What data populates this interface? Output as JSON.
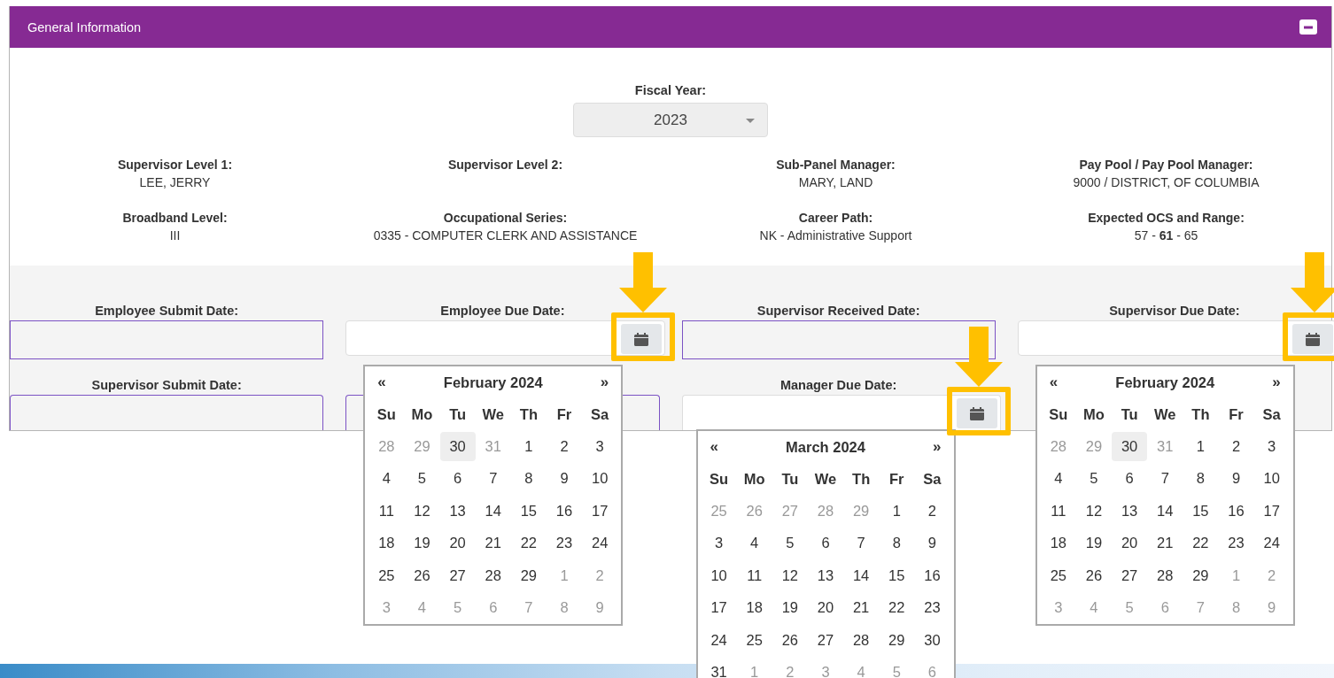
{
  "panel": {
    "title": "General Information",
    "expanded": true
  },
  "fiscal_year": {
    "label": "Fiscal Year:",
    "value": "2023"
  },
  "info": [
    {
      "label": "Supervisor Level 1:",
      "value": "LEE, JERRY"
    },
    {
      "label": "Supervisor Level 2:"
    },
    {
      "label": "Sub-Panel Manager:",
      "value": "MARY, LAND"
    },
    {
      "label": "Pay Pool / Pay Pool Manager:",
      "value": "9000 / DISTRICT, OF COLUMBIA"
    },
    {
      "label": "Broadband Level:",
      "value": "III"
    },
    {
      "label": "Occupational Series:",
      "value": "0335 - COMPUTER CLERK AND ASSISTANCE"
    },
    {
      "label": "Career Path:",
      "value": "NK - Administrative Support"
    },
    {
      "label": "Expected OCS and Range:",
      "value": "57 - **61** - 65"
    }
  ],
  "date_fields": [
    {
      "kind": "readonly",
      "label": "Employee Submit Date:"
    },
    {
      "kind": "picker",
      "label": "Employee Due Date:",
      "highlighted": true,
      "calendar": {
        "title": "February 2024",
        "prev": "«",
        "next": "»",
        "weekdays": [
          "Su",
          "Mo",
          "Tu",
          "We",
          "Th",
          "Fr",
          "Sa"
        ],
        "weeks": [
          [
            {
              "day": "28",
              "muted": true,
              "selected": false
            },
            {
              "day": "29",
              "muted": true,
              "selected": false
            },
            {
              "day": "30",
              "muted": false,
              "selected": true
            },
            {
              "day": "31",
              "muted": true,
              "selected": false
            },
            {
              "day": "1",
              "muted": false,
              "selected": false
            },
            {
              "day": "2",
              "muted": false,
              "selected": false
            },
            {
              "day": "3",
              "muted": false,
              "selected": false
            }
          ],
          [
            {
              "day": "4",
              "muted": false,
              "selected": false
            },
            {
              "day": "5",
              "muted": false,
              "selected": false
            },
            {
              "day": "6",
              "muted": false,
              "selected": false
            },
            {
              "day": "7",
              "muted": false,
              "selected": false
            },
            {
              "day": "8",
              "muted": false,
              "selected": false
            },
            {
              "day": "9",
              "muted": false,
              "selected": false
            },
            {
              "day": "10",
              "muted": false,
              "selected": false
            }
          ],
          [
            {
              "day": "11",
              "muted": false,
              "selected": false
            },
            {
              "day": "12",
              "muted": false,
              "selected": false
            },
            {
              "day": "13",
              "muted": false,
              "selected": false
            },
            {
              "day": "14",
              "muted": false,
              "selected": false
            },
            {
              "day": "15",
              "muted": false,
              "selected": false
            },
            {
              "day": "16",
              "muted": false,
              "selected": false
            },
            {
              "day": "17",
              "muted": false,
              "selected": false
            }
          ],
          [
            {
              "day": "18",
              "muted": false,
              "selected": false
            },
            {
              "day": "19",
              "muted": false,
              "selected": false
            },
            {
              "day": "20",
              "muted": false,
              "selected": false
            },
            {
              "day": "21",
              "muted": false,
              "selected": false
            },
            {
              "day": "22",
              "muted": false,
              "selected": false
            },
            {
              "day": "23",
              "muted": false,
              "selected": false
            },
            {
              "day": "24",
              "muted": false,
              "selected": false
            }
          ],
          [
            {
              "day": "25",
              "muted": false,
              "selected": false
            },
            {
              "day": "26",
              "muted": false,
              "selected": false
            },
            {
              "day": "27",
              "muted": false,
              "selected": false
            },
            {
              "day": "28",
              "muted": false,
              "selected": false
            },
            {
              "day": "29",
              "muted": false,
              "selected": false
            },
            {
              "day": "1",
              "muted": true,
              "selected": false
            },
            {
              "day": "2",
              "muted": true,
              "selected": false
            }
          ],
          [
            {
              "day": "3",
              "muted": true,
              "selected": false
            },
            {
              "day": "4",
              "muted": true,
              "selected": false
            },
            {
              "day": "5",
              "muted": true,
              "selected": false
            },
            {
              "day": "6",
              "muted": true,
              "selected": false
            },
            {
              "day": "7",
              "muted": true,
              "selected": false
            },
            {
              "day": "8",
              "muted": true,
              "selected": false
            },
            {
              "day": "9",
              "muted": true,
              "selected": false
            }
          ]
        ]
      }
    },
    {
      "kind": "readonly",
      "label": "Supervisor Received Date:"
    },
    {
      "kind": "picker",
      "label": "Supervisor Due Date:",
      "highlighted": true,
      "calendar": {
        "title": "February 2024",
        "prev": "«",
        "next": "»",
        "weekdays": [
          "Su",
          "Mo",
          "Tu",
          "We",
          "Th",
          "Fr",
          "Sa"
        ],
        "weeks": [
          [
            {
              "day": "28",
              "muted": true,
              "selected": false
            },
            {
              "day": "29",
              "muted": true,
              "selected": false
            },
            {
              "day": "30",
              "muted": false,
              "selected": true
            },
            {
              "day": "31",
              "muted": true,
              "selected": false
            },
            {
              "day": "1",
              "muted": false,
              "selected": false
            },
            {
              "day": "2",
              "muted": false,
              "selected": false
            },
            {
              "day": "3",
              "muted": false,
              "selected": false
            }
          ],
          [
            {
              "day": "4",
              "muted": false,
              "selected": false
            },
            {
              "day": "5",
              "muted": false,
              "selected": false
            },
            {
              "day": "6",
              "muted": false,
              "selected": false
            },
            {
              "day": "7",
              "muted": false,
              "selected": false
            },
            {
              "day": "8",
              "muted": false,
              "selected": false
            },
            {
              "day": "9",
              "muted": false,
              "selected": false
            },
            {
              "day": "10",
              "muted": false,
              "selected": false
            }
          ],
          [
            {
              "day": "11",
              "muted": false,
              "selected": false
            },
            {
              "day": "12",
              "muted": false,
              "selected": false
            },
            {
              "day": "13",
              "muted": false,
              "selected": false
            },
            {
              "day": "14",
              "muted": false,
              "selected": false
            },
            {
              "day": "15",
              "muted": false,
              "selected": false
            },
            {
              "day": "16",
              "muted": false,
              "selected": false
            },
            {
              "day": "17",
              "muted": false,
              "selected": false
            }
          ],
          [
            {
              "day": "18",
              "muted": false,
              "selected": false
            },
            {
              "day": "19",
              "muted": false,
              "selected": false
            },
            {
              "day": "20",
              "muted": false,
              "selected": false
            },
            {
              "day": "21",
              "muted": false,
              "selected": false
            },
            {
              "day": "22",
              "muted": false,
              "selected": false
            },
            {
              "day": "23",
              "muted": false,
              "selected": false
            },
            {
              "day": "24",
              "muted": false,
              "selected": false
            }
          ],
          [
            {
              "day": "25",
              "muted": false,
              "selected": false
            },
            {
              "day": "26",
              "muted": false,
              "selected": false
            },
            {
              "day": "27",
              "muted": false,
              "selected": false
            },
            {
              "day": "28",
              "muted": false,
              "selected": false
            },
            {
              "day": "29",
              "muted": false,
              "selected": false
            },
            {
              "day": "1",
              "muted": true,
              "selected": false
            },
            {
              "day": "2",
              "muted": true,
              "selected": false
            }
          ],
          [
            {
              "day": "3",
              "muted": true,
              "selected": false
            },
            {
              "day": "4",
              "muted": true,
              "selected": false
            },
            {
              "day": "5",
              "muted": true,
              "selected": false
            },
            {
              "day": "6",
              "muted": true,
              "selected": false
            },
            {
              "day": "7",
              "muted": true,
              "selected": false
            },
            {
              "day": "8",
              "muted": true,
              "selected": false
            },
            {
              "day": "9",
              "muted": true,
              "selected": false
            }
          ]
        ]
      }
    },
    {
      "kind": "readonly",
      "label": "Supervisor Submit Date:"
    },
    {
      "kind": "readonly"
    },
    {
      "kind": "picker",
      "label": "Manager Due Date:",
      "highlighted": true,
      "calendar": {
        "title": "March 2024",
        "prev": "«",
        "next": "»",
        "weekdays": [
          "Su",
          "Mo",
          "Tu",
          "We",
          "Th",
          "Fr",
          "Sa"
        ],
        "weeks": [
          [
            {
              "day": "25",
              "muted": true,
              "selected": false
            },
            {
              "day": "26",
              "muted": true,
              "selected": false
            },
            {
              "day": "27",
              "muted": true,
              "selected": false
            },
            {
              "day": "28",
              "muted": true,
              "selected": false
            },
            {
              "day": "29",
              "muted": true,
              "selected": false
            },
            {
              "day": "1",
              "muted": false,
              "selected": false
            },
            {
              "day": "2",
              "muted": false,
              "selected": false
            }
          ],
          [
            {
              "day": "3",
              "muted": false,
              "selected": false
            },
            {
              "day": "4",
              "muted": false,
              "selected": false
            },
            {
              "day": "5",
              "muted": false,
              "selected": false
            },
            {
              "day": "6",
              "muted": false,
              "selected": false
            },
            {
              "day": "7",
              "muted": false,
              "selected": false
            },
            {
              "day": "8",
              "muted": false,
              "selected": false
            },
            {
              "day": "9",
              "muted": false,
              "selected": false
            }
          ],
          [
            {
              "day": "10",
              "muted": false,
              "selected": false
            },
            {
              "day": "11",
              "muted": false,
              "selected": false
            },
            {
              "day": "12",
              "muted": false,
              "selected": false
            },
            {
              "day": "13",
              "muted": false,
              "selected": false
            },
            {
              "day": "14",
              "muted": false,
              "selected": false
            },
            {
              "day": "15",
              "muted": false,
              "selected": false
            },
            {
              "day": "16",
              "muted": false,
              "selected": false
            }
          ],
          [
            {
              "day": "17",
              "muted": false,
              "selected": false
            },
            {
              "day": "18",
              "muted": false,
              "selected": false
            },
            {
              "day": "19",
              "muted": false,
              "selected": false
            },
            {
              "day": "20",
              "muted": false,
              "selected": false
            },
            {
              "day": "21",
              "muted": false,
              "selected": false
            },
            {
              "day": "22",
              "muted": false,
              "selected": false
            },
            {
              "day": "23",
              "muted": false,
              "selected": false
            }
          ],
          [
            {
              "day": "24",
              "muted": false,
              "selected": false
            },
            {
              "day": "25",
              "muted": false,
              "selected": false
            },
            {
              "day": "26",
              "muted": false,
              "selected": false
            },
            {
              "day": "27",
              "muted": false,
              "selected": false
            },
            {
              "day": "28",
              "muted": false,
              "selected": false
            },
            {
              "day": "29",
              "muted": false,
              "selected": false
            },
            {
              "day": "30",
              "muted": false,
              "selected": false
            }
          ],
          [
            {
              "day": "31",
              "muted": false,
              "selected": false
            },
            {
              "day": "1",
              "muted": true,
              "selected": false
            },
            {
              "day": "2",
              "muted": true,
              "selected": false
            },
            {
              "day": "3",
              "muted": true,
              "selected": false
            },
            {
              "day": "4",
              "muted": true,
              "selected": false
            },
            {
              "day": "5",
              "muted": true,
              "selected": false
            },
            {
              "day": "6",
              "muted": true,
              "selected": false
            }
          ]
        ]
      }
    }
  ]
}
